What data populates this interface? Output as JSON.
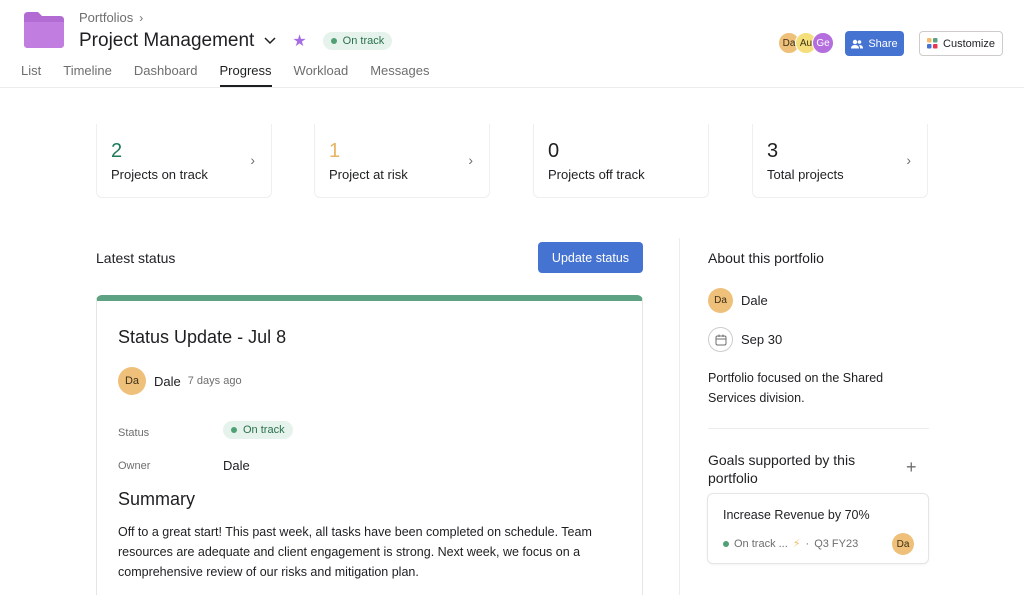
{
  "header": {
    "breadcrumb": "Portfolios",
    "title": "Project Management",
    "status": "On track",
    "accent": "#a66de3",
    "avatars": [
      "Da",
      "Au",
      "Ge"
    ],
    "share_label": "Share",
    "customize_label": "Customize"
  },
  "tabs": [
    "List",
    "Timeline",
    "Dashboard",
    "Progress",
    "Workload",
    "Messages"
  ],
  "active_tab": "Progress",
  "stats": [
    {
      "value": "2",
      "label": "Projects on track",
      "color": "#1d7b57"
    },
    {
      "value": "1",
      "label": "Project at risk",
      "color": "#e7b463"
    },
    {
      "value": "0",
      "label": "Projects off track",
      "color": "#1e1f21"
    },
    {
      "value": "3",
      "label": "Total projects",
      "color": "#1e1f21"
    }
  ],
  "latest": {
    "title": "Latest status",
    "update_button": "Update status",
    "card": {
      "title": "Status Update - Jul 8",
      "author_initials": "Da",
      "author": "Dale",
      "time": "7 days ago",
      "status_label": "Status",
      "status_value": "On track",
      "owner_label": "Owner",
      "owner_value": "Dale",
      "summary_heading": "Summary",
      "summary_text": "Off to a great start! This past week, all tasks have been completed on schedule. Team resources are adequate and client engagement is strong. Next week, we focus on a comprehensive review of our risks and mitigation plan."
    }
  },
  "about": {
    "title": "About this portfolio",
    "owner_initials": "Da",
    "owner": "Dale",
    "date": "Sep 30",
    "description": "Portfolio focused on the Shared Services division.",
    "goals_title": "Goals supported by this portfolio",
    "goal": {
      "name": "Increase Revenue by 70%",
      "status": "On track ...",
      "period": "Q3 FY23",
      "owner_initials": "Da"
    }
  }
}
